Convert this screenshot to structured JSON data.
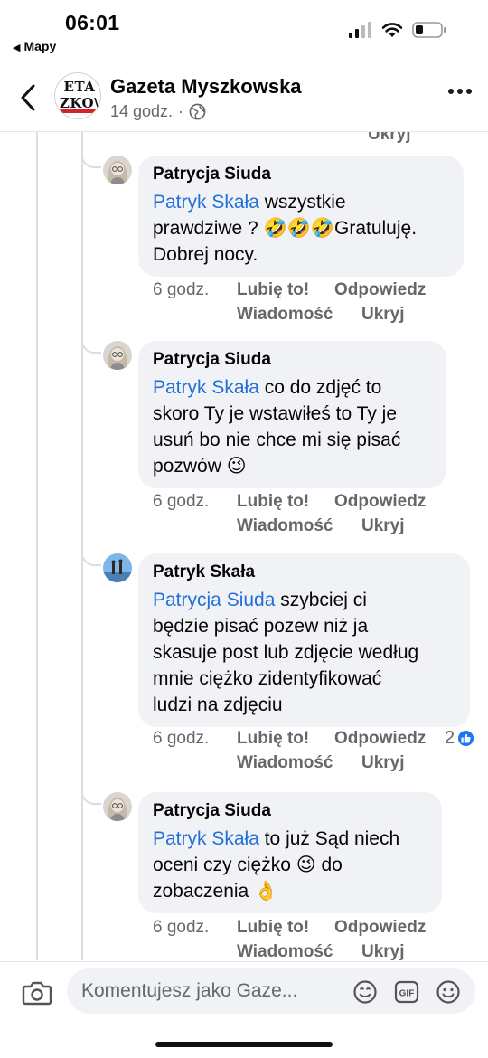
{
  "status_bar": {
    "time": "06:01",
    "back_app": "Mapy",
    "back_arrow": "◀"
  },
  "header": {
    "page_name": "Gazeta Myszkowska",
    "post_age": "14 godz.",
    "separator": "·",
    "logo_line1": "ETA",
    "logo_line2": "ZKO\\"
  },
  "thread_stub": "Ukryj",
  "comments": [
    {
      "author": "Patrycja Siuda",
      "mention": "Patryk Skała",
      "line_first_rest": " wszystkie",
      "lines": [
        "prawdziwe ? 🤣🤣🤣Gratuluję.",
        "Dobrej nocy."
      ],
      "time": "6 godz.",
      "like": "Lubię to!",
      "reply": "Odpowiedz",
      "message": "Wiadomość",
      "hide": "Ukryj"
    },
    {
      "author": "Patrycja Siuda",
      "mention": "Patryk Skała",
      "line_first_rest": " co do zdjęć to",
      "lines": [
        "skoro Ty je wstawiłeś to Ty je",
        "usuń bo nie chce mi się pisać",
        "pozwów 😉"
      ],
      "time": "6 godz.",
      "like": "Lubię to!",
      "reply": "Odpowiedz",
      "message": "Wiadomość",
      "hide": "Ukryj"
    },
    {
      "author": "Patryk Skała",
      "mention": "Patrycja Siuda",
      "line_first_rest": " szybciej ci",
      "lines": [
        "będzie pisać pozew niż ja",
        "skasuje post lub zdjęcie według",
        "mnie ciężko zidentyfikować",
        "ludzi na zdjęciu"
      ],
      "time": "6 godz.",
      "like": "Lubię to!",
      "reply": "Odpowiedz",
      "message": "Wiadomość",
      "hide": "Ukryj",
      "reaction_count": "2"
    },
    {
      "author": "Patrycja Siuda",
      "mention": "Patryk Skała",
      "line_first_rest": " to już Sąd niech",
      "lines": [
        "oceni czy ciężko 😉 do",
        "zobaczenia 👌"
      ],
      "time": "6 godz.",
      "like": "Lubię to!",
      "reply": "Odpowiedz",
      "message": "Wiadomość",
      "hide": "Ukryj"
    }
  ],
  "composer": {
    "placeholder": "Komentujesz jako Gaze...",
    "gif_label": "GIF"
  },
  "icons": {
    "back": "chevron-left-icon",
    "globe": "globe-icon",
    "more": "more-horizontal-icon",
    "camera": "camera-icon",
    "sticker": "sticker-icon",
    "gif": "gif-icon",
    "emoji": "emoji-icon",
    "like_badge": "thumbs-up-icon"
  },
  "colors": {
    "mention": "#216fdb",
    "bubble": "#f0f2f5",
    "meta": "#65676b",
    "like_badge": "#1877f2"
  }
}
